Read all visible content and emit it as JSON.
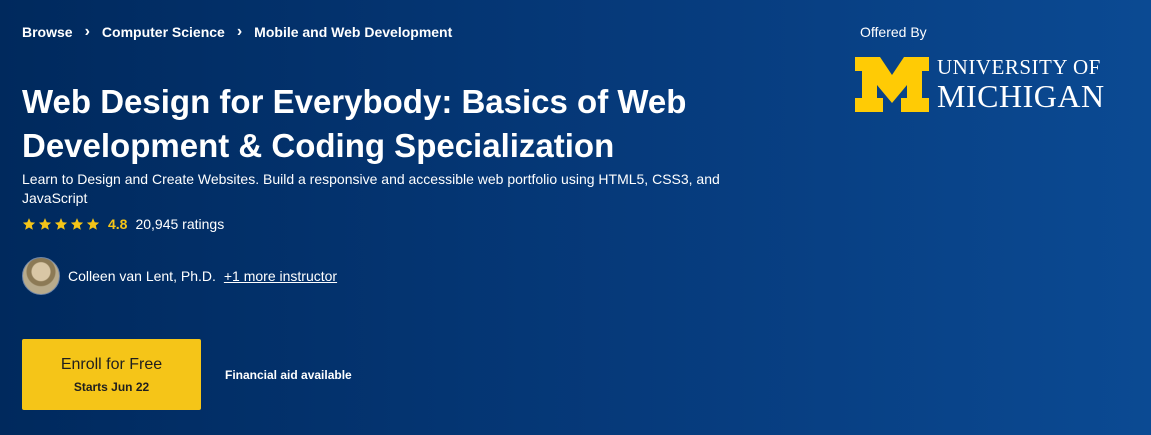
{
  "breadcrumb": {
    "items": [
      "Browse",
      "Computer Science",
      "Mobile and Web Development"
    ]
  },
  "course": {
    "title": "Web Design for Everybody: Basics of Web Development & Coding Specialization",
    "subtitle": "Learn to Design and Create Websites. Build a responsive and accessible web portfolio using HTML5, CSS3, and JavaScript"
  },
  "rating": {
    "stars": 5,
    "value": "4.8",
    "count": "20,945 ratings"
  },
  "instructor": {
    "name": "Colleen van Lent, Ph.D.",
    "more_link": "+1 more instructor"
  },
  "enroll": {
    "label": "Enroll for Free",
    "starts": "Starts Jun 22"
  },
  "financial_aid": "Financial aid available",
  "offered_by": {
    "label": "Offered By",
    "logo_line1": "UNIVERSITY OF",
    "logo_line2": "MICHIGAN"
  },
  "colors": {
    "background": "#00295d",
    "accent": "#f5c518",
    "text": "#ffffff"
  },
  "icons": [
    "chevron-right-icon",
    "star-icon",
    "avatar",
    "university-m-logo"
  ]
}
